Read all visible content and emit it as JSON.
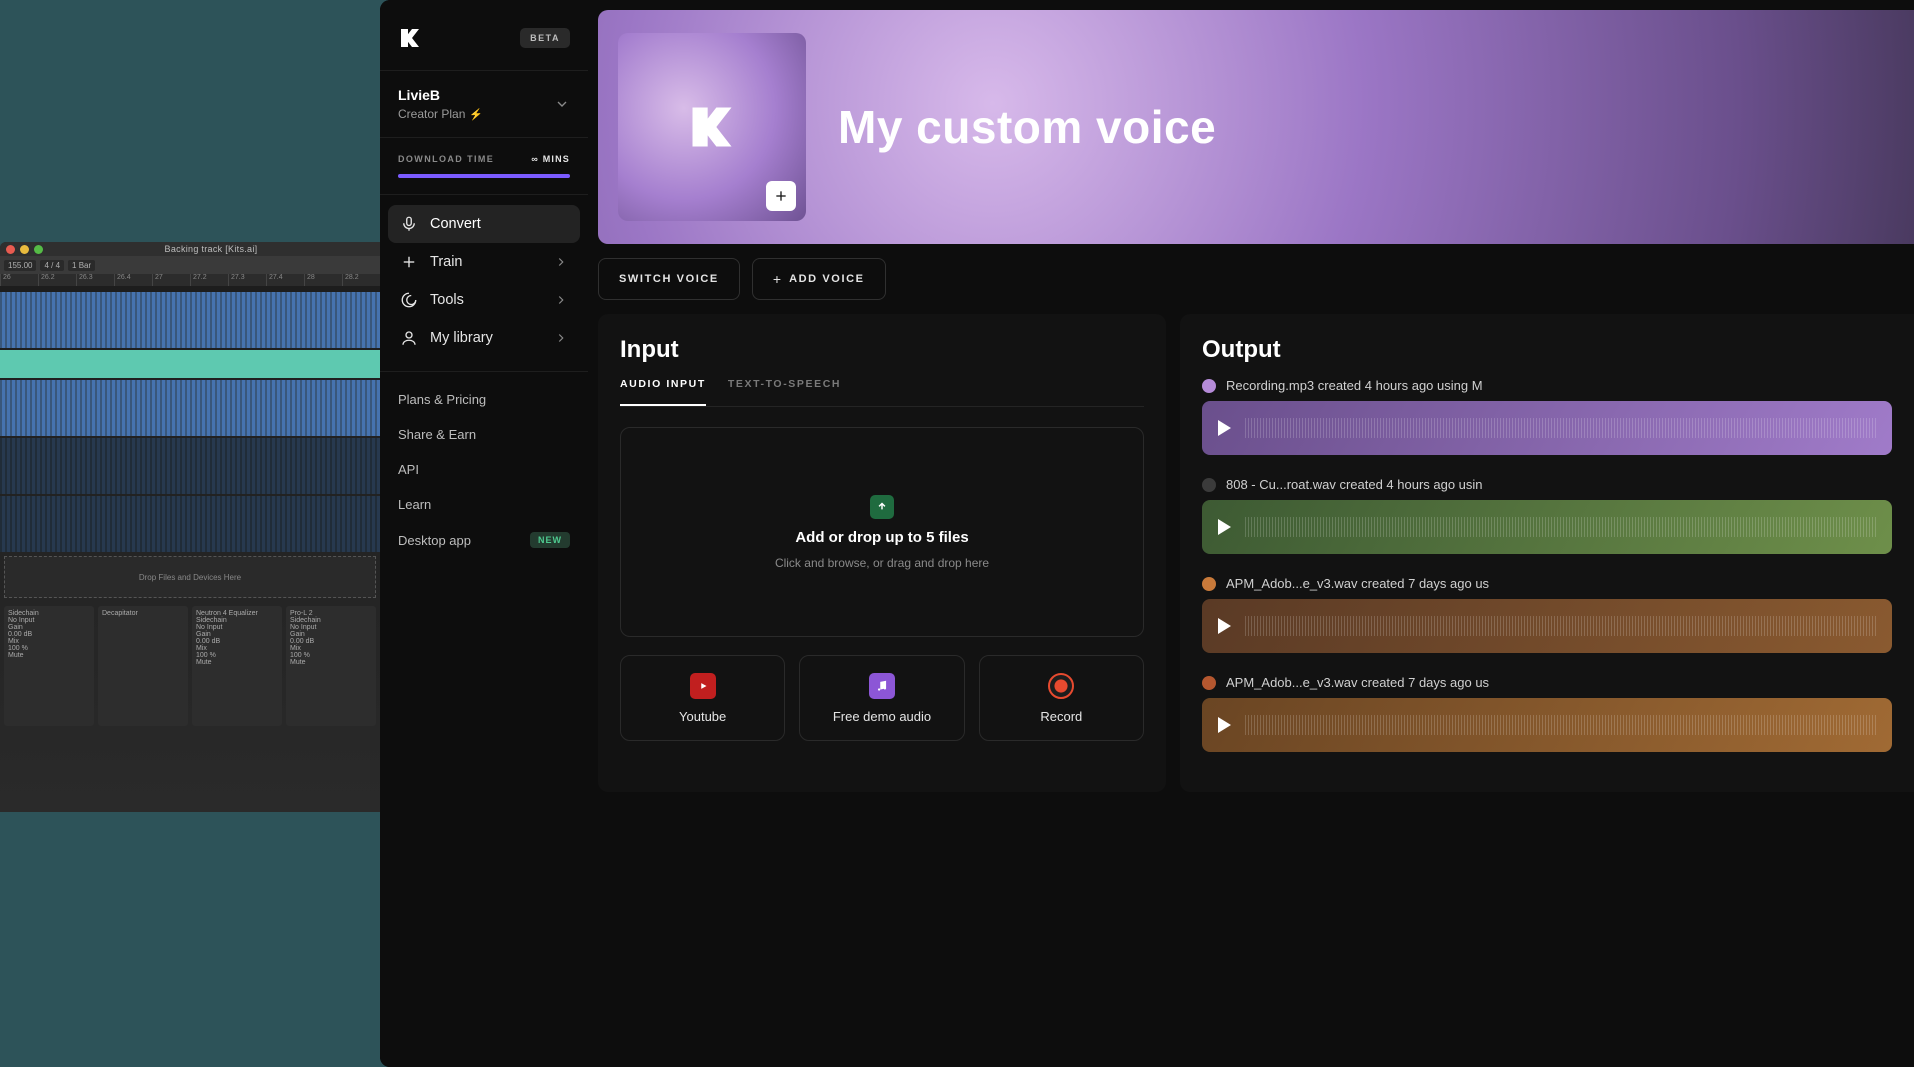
{
  "daw": {
    "title": "Backing track [Kits.ai]",
    "tempo": "155.00",
    "timesig": "4 / 4",
    "bar": "1 Bar",
    "drop": "Drop Files and Devices Here"
  },
  "sidebar": {
    "beta_label": "BETA",
    "user": {
      "name": "LivieB",
      "plan": "Creator Plan"
    },
    "download": {
      "label": "DOWNLOAD TIME",
      "value": "∞ MINS"
    },
    "nav": [
      {
        "label": "Convert",
        "icon": "mic",
        "active": true,
        "expandable": false
      },
      {
        "label": "Train",
        "icon": "plus",
        "active": false,
        "expandable": true
      },
      {
        "label": "Tools",
        "icon": "spiral",
        "active": false,
        "expandable": true
      },
      {
        "label": "My library",
        "icon": "user",
        "active": false,
        "expandable": true
      }
    ],
    "links": [
      {
        "label": "Plans & Pricing",
        "badge": null
      },
      {
        "label": "Share & Earn",
        "badge": null
      },
      {
        "label": "API",
        "badge": null
      },
      {
        "label": "Learn",
        "badge": null
      },
      {
        "label": "Desktop app",
        "badge": "NEW"
      }
    ]
  },
  "banner": {
    "title": "My custom voice"
  },
  "actions": {
    "switch": "SWITCH VOICE",
    "add": "ADD VOICE"
  },
  "input_panel": {
    "heading": "Input",
    "tabs": [
      {
        "label": "AUDIO INPUT",
        "active": true
      },
      {
        "label": "TEXT-TO-SPEECH",
        "active": false
      }
    ],
    "dropzone": {
      "title": "Add or drop up to 5 files",
      "subtitle": "Click and browse, or drag and drop here"
    },
    "sources": [
      {
        "label": "Youtube",
        "kind": "youtube"
      },
      {
        "label": "Free demo audio",
        "kind": "demo"
      },
      {
        "label": "Record",
        "kind": "record"
      }
    ]
  },
  "output_panel": {
    "heading": "Output",
    "items": [
      {
        "dot": "#b58bd8",
        "text": "Recording.mp3 created 4 hours ago using M",
        "grad": "g-purple"
      },
      {
        "dot": "#3b3b3b",
        "text": "808 - Cu...roat.wav created 4 hours ago usin",
        "grad": "g-green"
      },
      {
        "dot": "#c97a3a",
        "text": "APM_Adob...e_v3.wav created 7 days ago us",
        "grad": "g-orange"
      },
      {
        "dot": "#b5572f",
        "text": "APM_Adob...e_v3.wav created 7 days ago us",
        "grad": "g-amber"
      }
    ]
  }
}
